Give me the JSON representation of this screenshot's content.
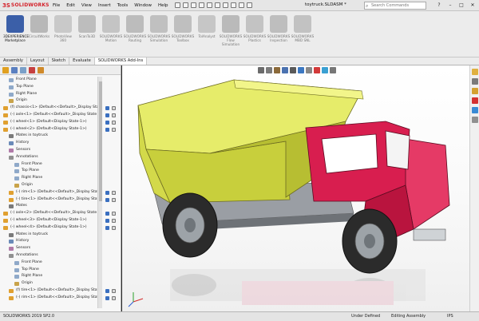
{
  "app": {
    "brand": "SOLIDWORKS",
    "menu": [
      "File",
      "Edit",
      "View",
      "Insert",
      "Tools",
      "Window",
      "Help"
    ],
    "document_title": "toytruck.SLDASM *",
    "search_placeholder": "Search Commands"
  },
  "ribbon": {
    "buttons": [
      {
        "label": "3DEXPERIENCE Marketplace",
        "active": true,
        "color": "#3b5fa8"
      },
      {
        "label": "CircuitWorks",
        "active": false,
        "color": "#b8b8b8"
      },
      {
        "label": "PhotoView 360",
        "active": false,
        "color": "#c9c9c9"
      },
      {
        "label": "ScanTo3D",
        "active": false,
        "color": "#bdbdbd"
      },
      {
        "label": "SOLIDWORKS Motion",
        "active": false,
        "color": "#c4c4c4"
      },
      {
        "label": "SOLIDWORKS Routing",
        "active": false,
        "color": "#bcbcbc"
      },
      {
        "label": "SOLIDWORKS Simulation",
        "active": false,
        "color": "#c0c0c0"
      },
      {
        "label": "SOLIDWORKS Toolbox",
        "active": false,
        "color": "#bfbfbf"
      },
      {
        "label": "TolAnalyst",
        "active": false,
        "color": "#c6c6c6"
      },
      {
        "label": "SOLIDWORKS Flow Simulation",
        "active": false,
        "color": "#bababa"
      },
      {
        "label": "SOLIDWORKS Plastics",
        "active": false,
        "color": "#c3c3c3"
      },
      {
        "label": "SOLIDWORKS Inspection",
        "active": false,
        "color": "#bebebe"
      },
      {
        "label": "SOLIDWORKS MBD SNL",
        "active": false,
        "color": "#c2c2c2"
      }
    ]
  },
  "tabs": [
    {
      "label": "Assembly",
      "selected": false
    },
    {
      "label": "Layout",
      "selected": false
    },
    {
      "label": "Sketch",
      "selected": false
    },
    {
      "label": "Evaluate",
      "selected": false
    },
    {
      "label": "SOLIDWORKS Add-Ins",
      "selected": true
    }
  ],
  "tree": [
    {
      "label": "Front Plane",
      "indent": 1,
      "icon": "plane"
    },
    {
      "label": "Top Plane",
      "indent": 1,
      "icon": "plane"
    },
    {
      "label": "Right Plane",
      "indent": 1,
      "icon": "plane"
    },
    {
      "label": "Origin",
      "indent": 1,
      "icon": "origin"
    },
    {
      "label": "(f) chassis<1> (Default<<Default>_Display State 1>)",
      "indent": 0,
      "icon": "part"
    },
    {
      "label": "(-) axle<1> (Default<<Default>_Display State 1>)",
      "indent": 0,
      "icon": "part"
    },
    {
      "label": "(-) wheel<1> (Default<Display State-1>)",
      "indent": 0,
      "icon": "part"
    },
    {
      "label": "(-) wheel<2> (Default<Display State-1>)",
      "indent": 0,
      "icon": "part"
    },
    {
      "label": "Mates in toytruck",
      "indent": 1,
      "icon": "mates"
    },
    {
      "label": "History",
      "indent": 1,
      "icon": "history"
    },
    {
      "label": "Sensors",
      "indent": 1,
      "icon": "sensor"
    },
    {
      "label": "Annotations",
      "indent": 1,
      "icon": "annot"
    },
    {
      "label": "Front Plane",
      "indent": 2,
      "icon": "plane"
    },
    {
      "label": "Top Plane",
      "indent": 2,
      "icon": "plane"
    },
    {
      "label": "Right Plane",
      "indent": 2,
      "icon": "plane"
    },
    {
      "label": "Origin",
      "indent": 2,
      "icon": "origin"
    },
    {
      "label": "(-) rim<1> (Default<<Default>_Display State 1>)",
      "indent": 1,
      "icon": "part"
    },
    {
      "label": "(-) tire<1> (Default<<Default>_Display State 1>)",
      "indent": 1,
      "icon": "part"
    },
    {
      "label": "Mates",
      "indent": 1,
      "icon": "mates"
    },
    {
      "label": "(-) axle<2> (Default<<Default>_Display State 1>)",
      "indent": 0,
      "icon": "part"
    },
    {
      "label": "(-) wheel<3> (Default<Display State-1>)",
      "indent": 0,
      "icon": "part"
    },
    {
      "label": "(-) wheel<4> (Default<Display State-1>)",
      "indent": 0,
      "icon": "part"
    },
    {
      "label": "Mates in toytruck",
      "indent": 1,
      "icon": "mates"
    },
    {
      "label": "History",
      "indent": 1,
      "icon": "history"
    },
    {
      "label": "Sensors",
      "indent": 1,
      "icon": "sensor"
    },
    {
      "label": "Annotations",
      "indent": 1,
      "icon": "annot"
    },
    {
      "label": "Front Plane",
      "indent": 2,
      "icon": "plane"
    },
    {
      "label": "Top Plane",
      "indent": 2,
      "icon": "plane"
    },
    {
      "label": "Right Plane",
      "indent": 2,
      "icon": "plane"
    },
    {
      "label": "Origin",
      "indent": 2,
      "icon": "origin"
    },
    {
      "label": "(f) tire<1> (Default<<Default>_Display State 1>)",
      "indent": 1,
      "icon": "part"
    },
    {
      "label": "(-) rim<1> (Default<<Default>_Display State 1>)",
      "indent": 1,
      "icon": "part"
    }
  ],
  "status": {
    "version": "SOLIDWORKS 2019 SP2.0",
    "state": "Under Defined",
    "mode": "Editing Assembly",
    "units": "IPS"
  },
  "colors": {
    "truck_body": "#d81e4f",
    "dump_bed": "#d7e04a",
    "chassis": "#9a9ea4",
    "tire": "#2b2b2b",
    "rim": "#9da3a8",
    "brand_red": "#d4212a"
  }
}
